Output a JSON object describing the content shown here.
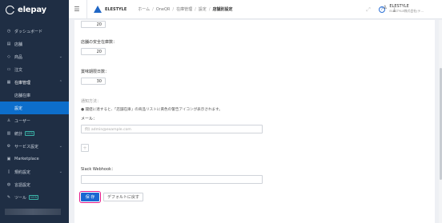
{
  "app": {
    "logo": "elepay"
  },
  "sidebar": {
    "items": [
      {
        "label": "ダッシュボード",
        "icon": "clock-icon"
      },
      {
        "label": "店舗",
        "icon": "store-icon"
      },
      {
        "label": "商品",
        "icon": "tag-icon",
        "chevron": "⌄"
      },
      {
        "label": "注文",
        "icon": "receipt-icon"
      },
      {
        "label": "在庫管理",
        "icon": "box-icon",
        "chevron": "⌃"
      },
      {
        "label": "店舗在庫",
        "icon": ""
      },
      {
        "label": "設定",
        "icon": ""
      },
      {
        "label": "ユーザー",
        "icon": "user-icon"
      },
      {
        "label": "統計",
        "icon": "chart-icon",
        "badge": "NEW"
      },
      {
        "label": "サービス設定",
        "icon": "settings-icon",
        "chevron": "⌄"
      },
      {
        "label": "Marketplace",
        "icon": "store-icon"
      },
      {
        "label": "規約設定",
        "icon": "doc-icon",
        "chevron": "⌄"
      },
      {
        "label": "言語設定",
        "icon": "globe-icon"
      },
      {
        "label": "ツール",
        "icon": "wrench-icon",
        "badge": "NEW"
      }
    ]
  },
  "topbar": {
    "brand": "ELESTYLE",
    "breadcrumb": [
      "ホーム",
      "OneQR",
      "在庫管理",
      "設定",
      "店舗別設定"
    ],
    "user_name": "ELESTYLE",
    "user_company": "ELESTYLE株式会社(テ..."
  },
  "form": {
    "field1_value": "20",
    "safety_label": "店舗の安全在庫数：",
    "safety_value": "20",
    "expiry_label": "賞味期限日数：",
    "expiry_value": "30",
    "notify_title": "通知方法：",
    "notify_text": "● 閾値に達すると、「店舗在庫」の商品リストに黄色の警告アイコンが表示されます。",
    "mail_label": "メール：",
    "mail_placeholder": "例) admin@example.com",
    "add_symbol": "+",
    "slack_label": "Slack Webhook：",
    "save_label": "保 存",
    "reset_label": "デフォルトに戻す"
  },
  "colors": {
    "sidebar": "#1f2e44",
    "accent": "#1a67d2",
    "highlight": "#e2198a"
  }
}
